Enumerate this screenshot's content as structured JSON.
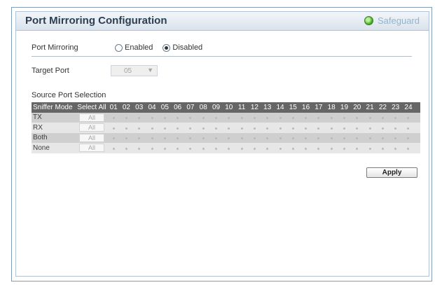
{
  "header": {
    "title": "Port Mirroring Configuration",
    "safeguard_label": "Safeguard"
  },
  "port_mirroring": {
    "label": "Port Mirroring",
    "options": [
      {
        "label": "Enabled",
        "checked": false
      },
      {
        "label": "Disabled",
        "checked": true
      }
    ]
  },
  "target_port": {
    "label": "Target Port",
    "value": "05"
  },
  "source_selection": {
    "title": "Source Port Selection",
    "header_mode": "Sniffer Mode",
    "header_all": "Select All",
    "ports": [
      "01",
      "02",
      "03",
      "04",
      "05",
      "06",
      "07",
      "08",
      "09",
      "10",
      "11",
      "12",
      "13",
      "14",
      "15",
      "16",
      "17",
      "18",
      "19",
      "20",
      "21",
      "22",
      "23",
      "24"
    ],
    "rows": [
      {
        "mode": "TX",
        "all": "All"
      },
      {
        "mode": "RX",
        "all": "All"
      },
      {
        "mode": "Both",
        "all": "All"
      },
      {
        "mode": "None",
        "all": "All"
      }
    ]
  },
  "apply_label": "Apply"
}
